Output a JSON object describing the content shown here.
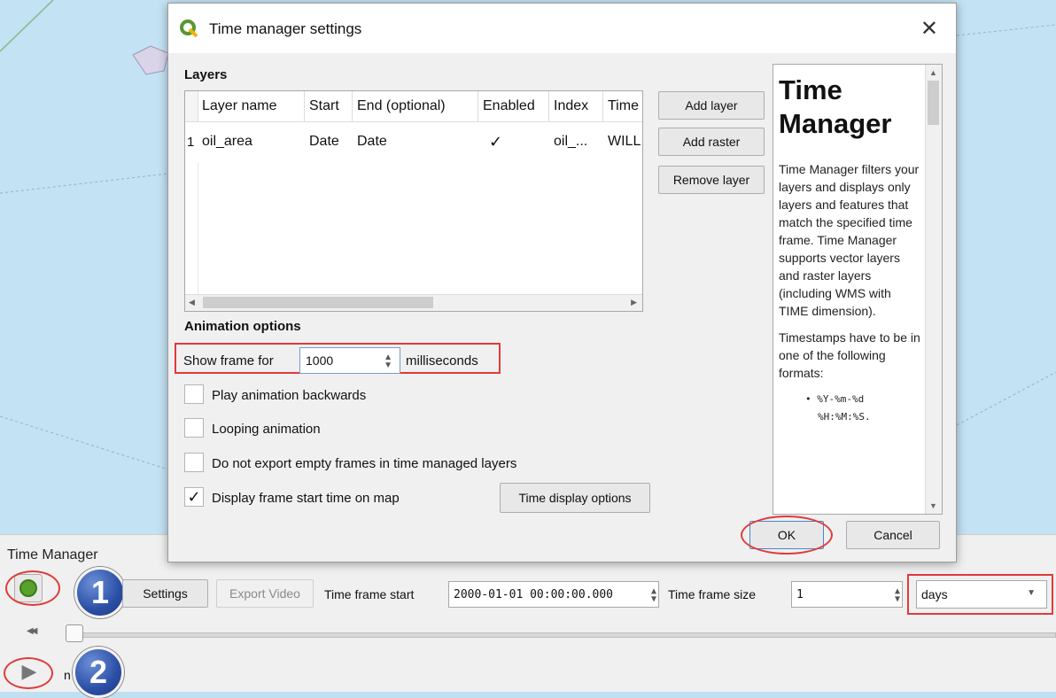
{
  "dialog": {
    "title": "Time manager settings",
    "layers_section": "Layers",
    "table": {
      "headers": [
        "Layer name",
        "Start",
        "End (optional)",
        "Enabled",
        "Index",
        "Time"
      ],
      "rows": [
        {
          "num": "1",
          "layer_name": "oil_area",
          "start": "Date",
          "end": "Date",
          "enabled": "✓",
          "index": "oil_...",
          "time": "WILL"
        }
      ]
    },
    "buttons": {
      "add_layer": "Add layer",
      "add_raster": "Add raster",
      "remove_layer": "Remove layer",
      "ok": "OK",
      "cancel": "Cancel",
      "time_display_options": "Time display options"
    },
    "animation": {
      "section": "Animation options",
      "show_frame_label": "Show frame for",
      "show_frame_value": "1000",
      "units": "milliseconds",
      "play_backwards": "Play animation backwards",
      "looping": "Looping animation",
      "no_export_empty": "Do not export empty frames in time managed layers",
      "display_start_time": "Display frame start time on map",
      "display_start_time_checked": "✓"
    },
    "help": {
      "title_line1": "Time",
      "title_line2": "Manager",
      "paragraph1": "Time Manager filters your layers and displays only layers and features that match the specified time frame. Time Manager supports vector layers and raster layers (including WMS with TIME dimension).",
      "paragraph2": "Timestamps have to be in one of the following formats:",
      "bullet1": "• %Y-%m-%d",
      "bullet2": "%H:%M:%S."
    },
    "close_glyph": "✕"
  },
  "panel": {
    "title": "Time Manager",
    "settings": "Settings",
    "export_video": "Export Video",
    "time_frame_start_label": "Time frame start",
    "time_frame_start_value": "2000-01-01 00:00:00.000",
    "time_frame_size_label": "Time frame size",
    "time_frame_size_value": "1",
    "unit_value": "days",
    "rewind_glyph": "◀◀",
    "play_glyph": "▶",
    "partial_label": "n"
  },
  "badges": [
    "1",
    "2"
  ],
  "colors": {
    "annotation_red": "#e03b3b",
    "badge_blue": "#2b4fa6",
    "power_green": "#5aa02c"
  }
}
